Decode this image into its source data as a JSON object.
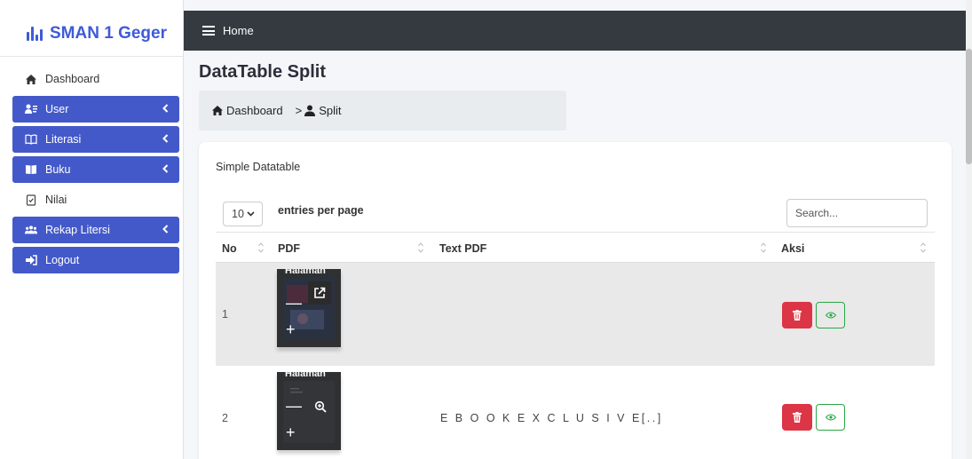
{
  "brand": {
    "name": "SMAN 1 Geger",
    "accent": "#3f5ad8"
  },
  "sidebar": {
    "items": [
      {
        "label": "Dashboard",
        "icon": "home-icon",
        "active": false
      },
      {
        "label": "User",
        "icon": "users-icon",
        "active": true,
        "chevron": true
      },
      {
        "label": "Literasi",
        "icon": "book-open-icon",
        "active": true,
        "chevron": true
      },
      {
        "label": "Buku",
        "icon": "book-icon",
        "active": true,
        "chevron": true
      },
      {
        "label": "Nilai",
        "icon": "checklist-icon",
        "active": false
      },
      {
        "label": "Rekap Litersi",
        "icon": "group-icon",
        "active": true,
        "chevron": true
      },
      {
        "label": "Logout",
        "icon": "logout-icon",
        "active": true
      }
    ],
    "active_color": "#4459c9"
  },
  "topbar": {
    "link": "Home"
  },
  "page": {
    "title": "DataTable Split"
  },
  "breadcrumb": {
    "home": "Dashboard",
    "separator": ">",
    "current": "Split"
  },
  "card": {
    "title": "Simple Datatable",
    "length_value": "10",
    "length_label": "entries per page",
    "search_placeholder": "Search..."
  },
  "table": {
    "columns": [
      "No",
      "PDF",
      "Text PDF",
      "Aksi"
    ],
    "rows": [
      {
        "no": "1",
        "pdf_label": "Halaman",
        "text": ""
      },
      {
        "no": "2",
        "pdf_label": "Halaman",
        "text": "E B O O K E X C L U S I V E[..]"
      }
    ]
  },
  "colors": {
    "danger": "#dc3545",
    "success": "#28a745",
    "topbar": "#343a40"
  }
}
